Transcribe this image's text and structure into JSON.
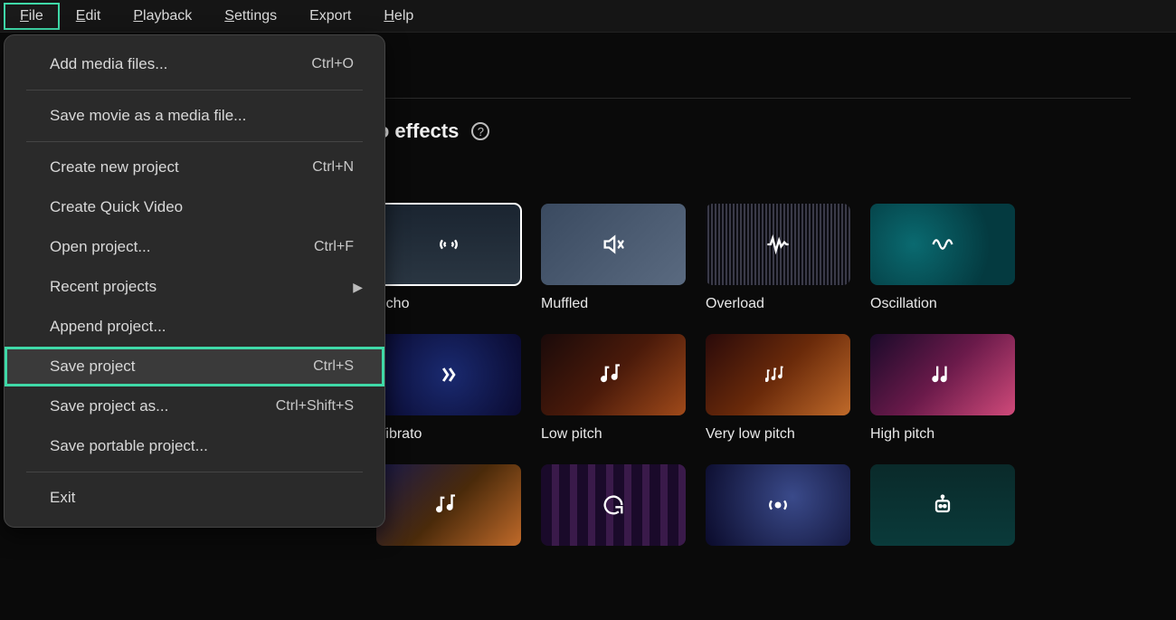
{
  "menubar": {
    "items": [
      {
        "label": "File",
        "underline": "F",
        "active": true
      },
      {
        "label": "Edit",
        "underline": "E"
      },
      {
        "label": "Playback",
        "underline": "P"
      },
      {
        "label": "Settings",
        "underline": "S"
      },
      {
        "label": "Export"
      },
      {
        "label": "Help",
        "underline": "H"
      }
    ]
  },
  "dropdown": {
    "items": [
      {
        "label": "Add media files...",
        "shortcut": "Ctrl+O"
      },
      {
        "sep": true
      },
      {
        "label": "Save movie as a media file..."
      },
      {
        "sep": true
      },
      {
        "label": "Create new project",
        "shortcut": "Ctrl+N"
      },
      {
        "label": "Create Quick Video"
      },
      {
        "label": "Open project...",
        "shortcut": "Ctrl+F"
      },
      {
        "label": "Recent projects",
        "submenu": true
      },
      {
        "label": "Append project..."
      },
      {
        "label": "Save project",
        "shortcut": "Ctrl+S",
        "highlight": true
      },
      {
        "label": "Save project as...",
        "shortcut": "Ctrl+Shift+S"
      },
      {
        "label": "Save portable project..."
      },
      {
        "sep": true
      },
      {
        "label": "Exit"
      }
    ]
  },
  "section": {
    "title": "Audio effects"
  },
  "effects": [
    {
      "label": "Echo",
      "icon": "echo-icon",
      "bg": "bg-echo",
      "selected": true
    },
    {
      "label": "Muffled",
      "icon": "muffled-icon",
      "bg": "bg-muffled"
    },
    {
      "label": "Overload",
      "icon": "overload-icon",
      "bg": "bg-overload"
    },
    {
      "label": "Oscillation",
      "icon": "oscillation-icon",
      "bg": "bg-osc"
    },
    {
      "label": "Vibrato",
      "icon": "vibrato-icon",
      "bg": "bg-vibrato"
    },
    {
      "label": "Low pitch",
      "icon": "lowpitch-icon",
      "bg": "bg-lowpitch"
    },
    {
      "label": "Very low pitch",
      "icon": "vlowpitch-icon",
      "bg": "bg-vlowpitch"
    },
    {
      "label": "High pitch",
      "icon": "highpitch-icon",
      "bg": "bg-highpitch"
    },
    {
      "label": "",
      "icon": "effect-icon-1",
      "bg": "bg-g1"
    },
    {
      "label": "",
      "icon": "effect-icon-2",
      "bg": "bg-g2"
    },
    {
      "label": "",
      "icon": "effect-icon-3",
      "bg": "bg-g3"
    },
    {
      "label": "",
      "icon": "effect-icon-4",
      "bg": "bg-g4"
    }
  ]
}
